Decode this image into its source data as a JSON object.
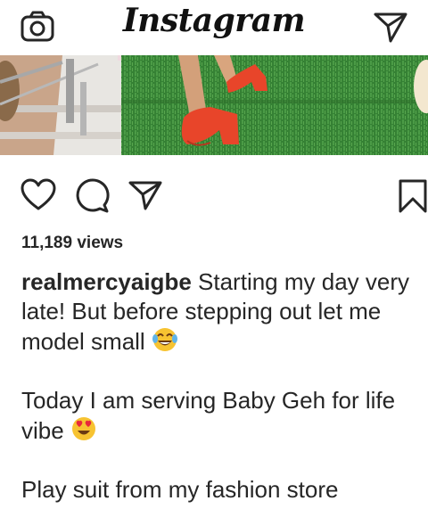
{
  "header": {
    "title": "Instagram",
    "left_icon": "camera-icon",
    "right_icon": "direct-message-icon"
  },
  "post": {
    "actions": {
      "like_icon": "heart-icon",
      "comment_icon": "comment-icon",
      "share_icon": "share-icon",
      "save_icon": "bookmark-icon"
    },
    "views": "11,189 views",
    "username": "realmercyaigbe",
    "caption_line1": "Starting my day very late! But before stepping out let me model small",
    "caption_line2": "Today I am serving Baby Geh for life vibe",
    "caption_line3": "Play suit from my fashion store",
    "emoji_1": "face-with-tears-of-joy-emoji",
    "emoji_2": "heart-eyes-emoji"
  },
  "colors": {
    "text": "#262626",
    "grass": "#3c8a3a",
    "shoe": "#e8452a"
  }
}
